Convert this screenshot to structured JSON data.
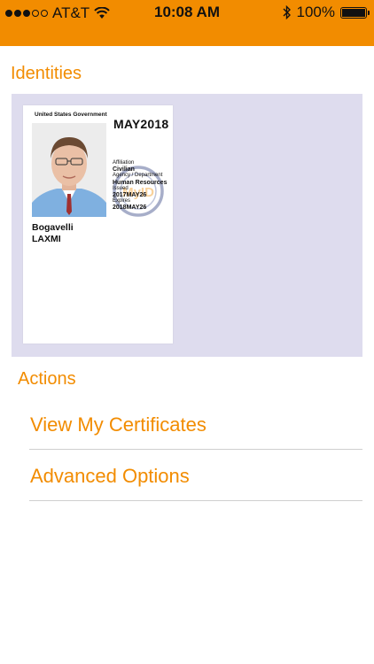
{
  "status_bar": {
    "carrier": "AT&T",
    "time": "10:08 AM",
    "battery": "100%",
    "signal_bars_filled": 3,
    "signal_bars_total": 5,
    "battery_level": 1.0,
    "icons": [
      "signal-dots-icon",
      "wifi-icon",
      "bluetooth-icon",
      "battery-icon"
    ]
  },
  "identities": {
    "title": "Identities",
    "cards": [
      {
        "issuer": "United States Government",
        "expiry_header": "MAY2018",
        "affiliation_label": "Affiliation",
        "affiliation": "Civilian",
        "agency_label": "Agency / Department",
        "agency": "Human Resources",
        "issued_label": "Issued",
        "issued": "2017MAY26",
        "expires_label": "Expires",
        "expires": "2018MAY26",
        "watermark_text": "MyID",
        "last_name": "Bogavelli",
        "first_name": "LAXMI"
      }
    ]
  },
  "actions": {
    "title": "Actions",
    "items": [
      {
        "label": "View My Certificates"
      },
      {
        "label": "Advanced Options"
      }
    ]
  },
  "colors": {
    "accent": "#f28c00",
    "panel_background": "#dedcee",
    "divider": "#cfcfcf"
  }
}
